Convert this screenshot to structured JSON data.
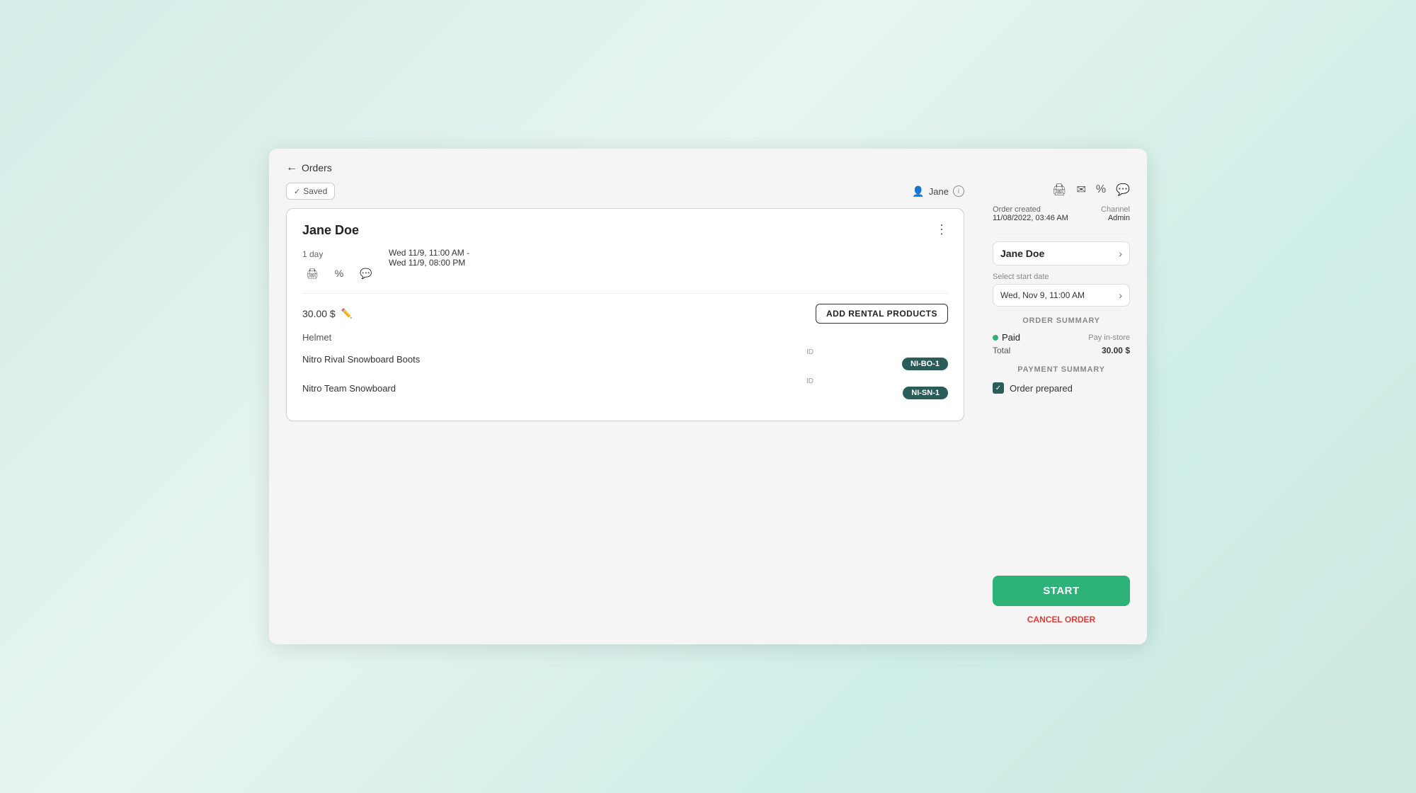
{
  "nav": {
    "back_label": "Orders"
  },
  "header": {
    "saved_label": "Saved",
    "user_name": "Jane",
    "info_tooltip": "i"
  },
  "order_card": {
    "customer_name": "Jane Doe",
    "duration": "1 day",
    "date_start": "Wed 11/9, 11:00 AM -",
    "date_end": "Wed 11/9, 08:00 PM",
    "price": "30.00 $",
    "add_rental_label": "ADD RENTAL PRODUCTS",
    "product_category": "Helmet",
    "products": [
      {
        "name": "Nitro Rival Snowboard Boots",
        "id_label": "ID",
        "id_value": "NI-BO-1"
      },
      {
        "name": "Nitro Team Snowboard",
        "id_label": "ID",
        "id_value": "NI-SN-1"
      }
    ]
  },
  "sidebar": {
    "print_icon": "🖨",
    "mail_icon": "✉",
    "percent_icon": "%",
    "chat_icon": "💬",
    "order_created_label": "Order created",
    "order_created_date": "11/08/2022, 03:46 AM",
    "channel_label": "Channel",
    "channel_value": "Admin",
    "customer_name": "Jane Doe",
    "chevron": "›",
    "start_date_label": "Select start date",
    "start_date_value": "Wed, Nov 9, 11:00 AM",
    "order_summary_label": "ORDER SUMMARY",
    "paid_label": "Paid",
    "pay_instore_label": "Pay in-store",
    "total_label": "Total",
    "total_value": "30.00 $",
    "payment_summary_label": "PAYMENT SUMMARY",
    "order_prepared_label": "Order prepared",
    "start_button_label": "START",
    "cancel_order_label": "CANCEL ORDER"
  }
}
